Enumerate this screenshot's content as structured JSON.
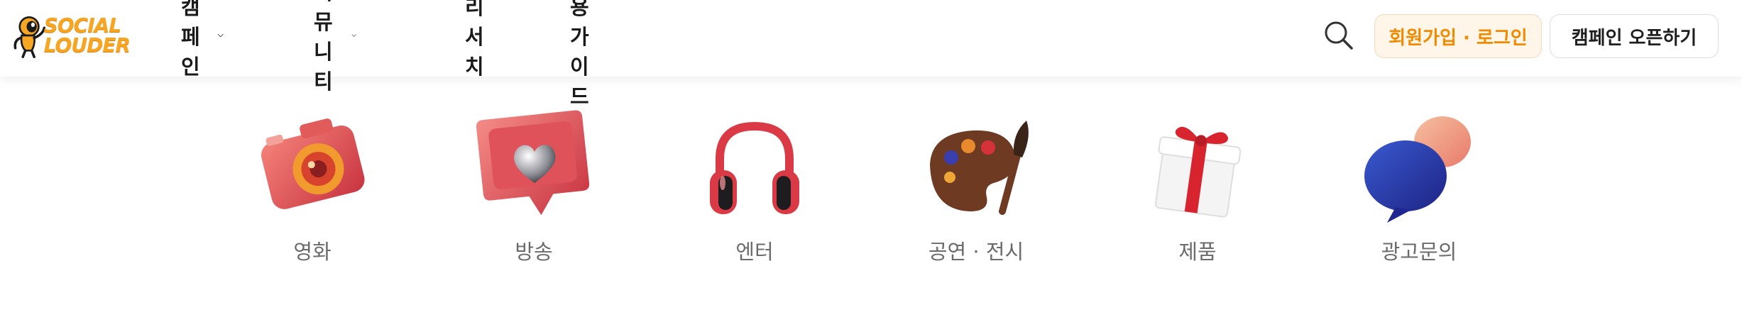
{
  "brand": {
    "logo_text": "SOCIAL\nLOUDER",
    "accent": "#f6a623"
  },
  "nav": {
    "items": [
      {
        "label": "캠페인",
        "has_dropdown": true
      },
      {
        "label": "커뮤니티",
        "has_dropdown": true
      },
      {
        "label": "리서치",
        "has_dropdown": false
      },
      {
        "label": "이용가이드",
        "has_dropdown": false
      }
    ]
  },
  "actions": {
    "search_icon": "search-icon",
    "login_label": "회원가입 · 로그인",
    "open_campaign_label": "캠페인 오픈하기"
  },
  "categories": [
    {
      "label": "영화",
      "icon": "camera-icon"
    },
    {
      "label": "방송",
      "icon": "heart-notification-icon"
    },
    {
      "label": "엔터",
      "icon": "headphones-icon"
    },
    {
      "label": "공연 · 전시",
      "icon": "palette-icon"
    },
    {
      "label": "제품",
      "icon": "gift-icon"
    },
    {
      "label": "광고문의",
      "icon": "chat-bubbles-icon"
    }
  ],
  "colors": {
    "primary_orange": "#f18a00",
    "text_dark": "#1a1a1a",
    "text_muted": "#6b6b6b"
  }
}
